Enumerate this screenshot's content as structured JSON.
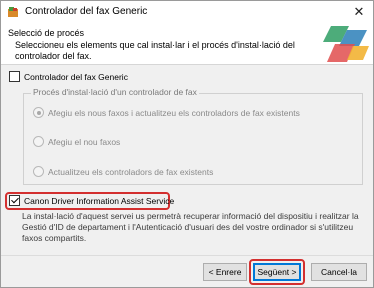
{
  "window": {
    "title": "Controlador del fax Generic",
    "close_glyph": "✕"
  },
  "header": {
    "title": "Selecció de procés",
    "description": "Seleccioneu els elements que cal instal·lar i el procés d'instal·lació del controlador del fax."
  },
  "fax_driver_option": {
    "label": "Controlador del fax Generic",
    "checked": false
  },
  "install_process": {
    "group_title": "Procés d'instal·lació d'un controlador de fax",
    "options": [
      {
        "label": "Afegiu els nous faxos i actualitzeu els controladors de fax existents",
        "selected": true
      },
      {
        "label": "Afegiu el nou faxos",
        "selected": false
      },
      {
        "label": "Actualitzeu els controladors de fax existents",
        "selected": false
      }
    ]
  },
  "canon_service_option": {
    "label": "Canon Driver Information Assist Service",
    "checked": true,
    "description": "La instal·lació d'aquest servei us permetrà recuperar informació del dispositiu i realitzar la Gestió d'ID de departament i l'Autenticació d'usuari des del vostre ordinador si s'utilitzeu faxos compartits."
  },
  "buttons": {
    "back": "< Enrere",
    "next": "Següent >",
    "cancel": "Cancel·la"
  },
  "colors": {
    "highlight": "#d32f2f",
    "default_button_border": "#0078d7"
  }
}
